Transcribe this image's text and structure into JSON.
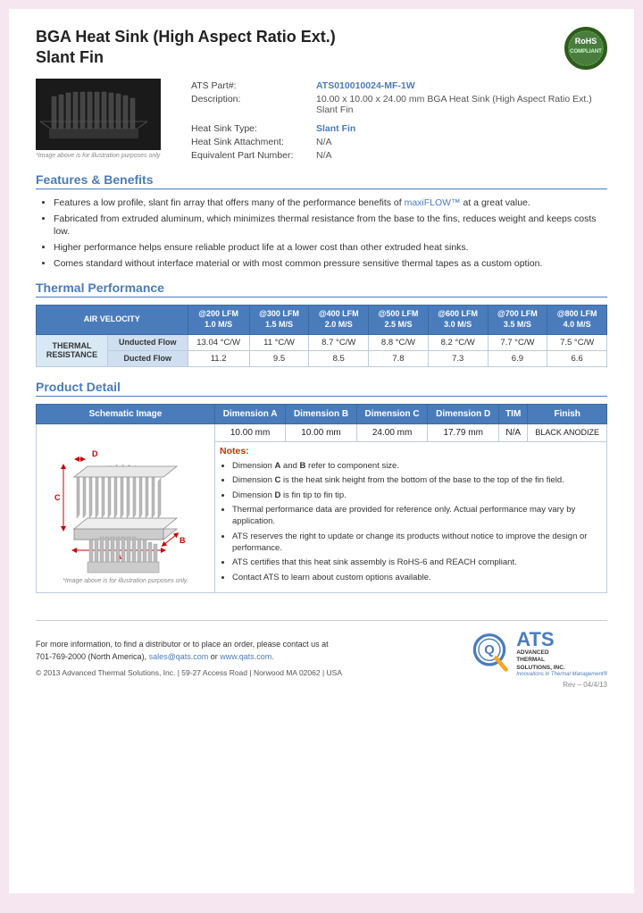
{
  "page": {
    "title_line1": "BGA Heat Sink (High Aspect Ratio Ext.)",
    "title_line2": "Slant Fin",
    "rohs": {
      "line1": "RoHS",
      "line2": "COMPLIANT"
    },
    "part_label": "ATS Part#:",
    "part_number": "ATS010010024-MF-1W",
    "description_label": "Description:",
    "description": "10.00 x 10.00 x 24.00 mm BGA Heat Sink (High Aspect Ratio Ext.) Slant Fin",
    "heatsink_type_label": "Heat Sink Type:",
    "heatsink_type": "Slant Fin",
    "attachment_label": "Heat Sink Attachment:",
    "attachment": "N/A",
    "equiv_label": "Equivalent Part Number:",
    "equiv": "N/A",
    "image_caption": "*Image above is for illustration purposes only",
    "features_heading": "Features & Benefits",
    "features": [
      "Features a low profile, slant fin array that offers many of the performance benefits of maxiFLOW™ at a great value.",
      "Fabricated from extruded aluminum, which minimizes thermal resistance from the base to the fins, reduces weight and keeps costs low.",
      "Higher performance helps ensure reliable product life at a lower cost than other extruded heat sinks.",
      "Comes standard without interface material or with most common pressure sensitive thermal tapes as a custom option."
    ],
    "maxiflow_link": "maxiFLOW™",
    "thermal_heading": "Thermal Performance",
    "thermal_table": {
      "col_headers": [
        {
          "line1": "AIR VELOCITY",
          "line2": ""
        },
        {
          "line1": "@200 LFM",
          "line2": "1.0 M/S"
        },
        {
          "line1": "@300 LFM",
          "line2": "1.5 M/S"
        },
        {
          "line1": "@400 LFM",
          "line2": "2.0 M/S"
        },
        {
          "line1": "@500 LFM",
          "line2": "2.5 M/S"
        },
        {
          "line1": "@600 LFM",
          "line2": "3.0 M/S"
        },
        {
          "line1": "@700 LFM",
          "line2": "3.5 M/S"
        },
        {
          "line1": "@800 LFM",
          "line2": "4.0 M/S"
        }
      ],
      "section_label": "THERMAL RESISTANCE",
      "rows": [
        {
          "label": "Unducted Flow",
          "values": [
            "13.04 °C/W",
            "11 °C/W",
            "8.7 °C/W",
            "8.8 °C/W",
            "8.2 °C/W",
            "7.7 °C/W",
            "7.5 °C/W"
          ]
        },
        {
          "label": "Ducted Flow",
          "values": [
            "11.2",
            "9.5",
            "8.5",
            "7.8",
            "7.3",
            "6.9",
            "6.6"
          ]
        }
      ]
    },
    "detail_heading": "Product Detail",
    "detail_table": {
      "headers": [
        "Schematic Image",
        "Dimension A",
        "Dimension B",
        "Dimension C",
        "Dimension D",
        "TIM",
        "Finish"
      ],
      "dim_values": [
        "10.00 mm",
        "10.00 mm",
        "24.00 mm",
        "17.79 mm",
        "N/A",
        "BLACK ANODIZE"
      ],
      "schematic_caption": "*Image above is for illustration purposes only.",
      "notes_title": "Notes:",
      "notes": [
        "Dimension A and B refer to component size.",
        "Dimension C is the heat sink height from the bottom of the base to the top of the fin field.",
        "Dimension D is fin tip to fin tip.",
        "Thermal performance data are provided for reference only. Actual performance may vary by application.",
        "ATS reserves the right to update or change its products without notice to improve the design or performance.",
        "ATS certifies that this heat sink assembly is RoHS-6 and REACH compliant.",
        "Contact ATS to learn about custom options available."
      ]
    },
    "footer": {
      "contact_text": "For more information, to find a distributor or to place an order, please contact us at\n701-769-2000 (North America), sales@qats.com or www.qats.com.",
      "email": "sales@qats.com",
      "website": "www.qats.com.",
      "copyright": "© 2013 Advanced Thermal Solutions, Inc.  |  59-27 Access Road  |  Norwood MA   02062  |  USA",
      "ats_abbr": "ATS",
      "ats_fullname": "ADVANCED\nTHERMAL\nSOLUTIONS, INC.",
      "ats_slogan": "Innovations in Thermal Management®",
      "rev": "Rev – 04/4/13"
    }
  }
}
